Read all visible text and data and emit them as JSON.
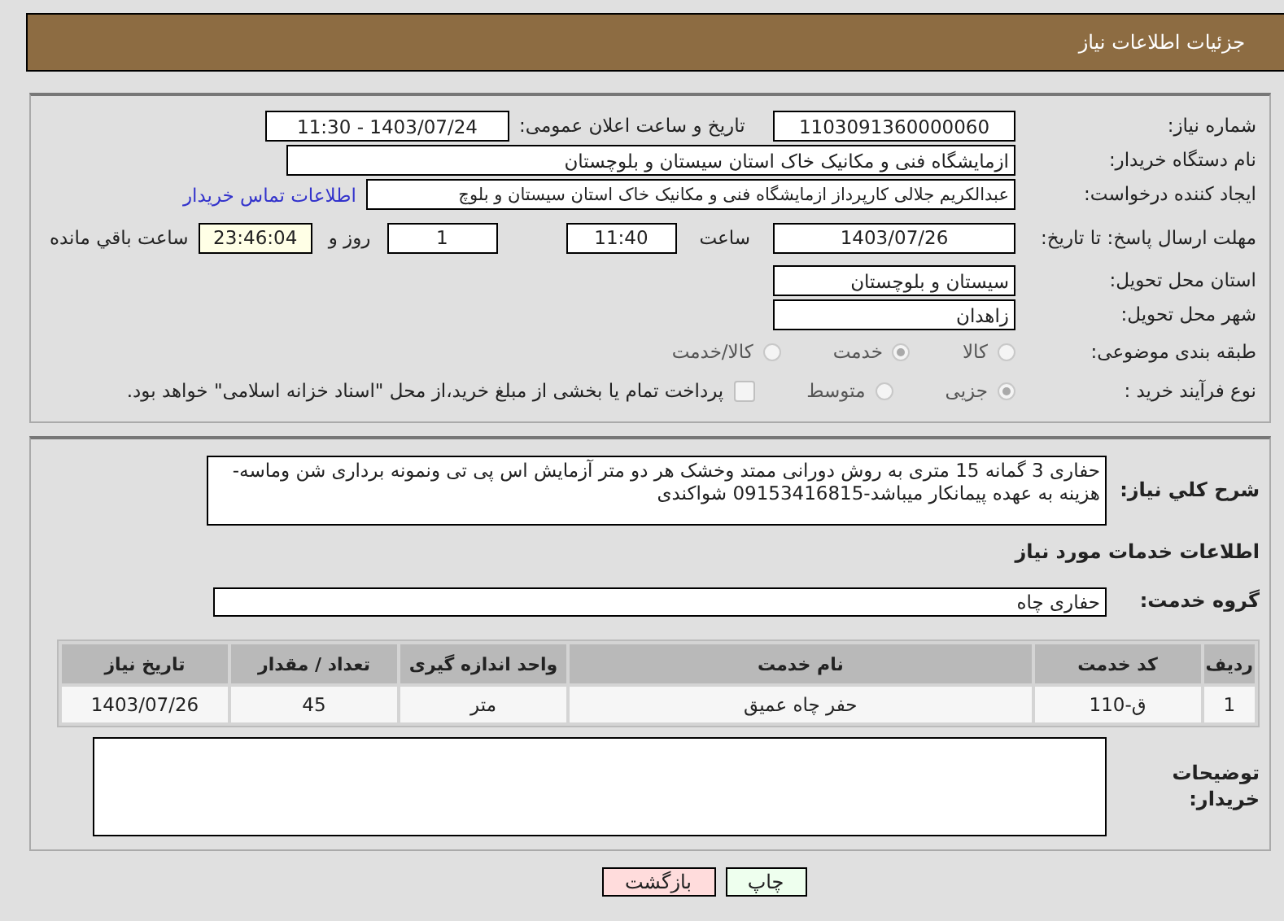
{
  "header": {
    "title": "جزئیات اطلاعات نیاز"
  },
  "need_number": {
    "label": "شماره نیاز:",
    "value": "1103091360000060"
  },
  "announce": {
    "label": "تاریخ و ساعت اعلان عمومی:",
    "value": "1403/07/24 - 11:30"
  },
  "buyer": {
    "label": "نام دستگاه خریدار:",
    "value": "ازمایشگاه فنی و مکانیک خاک استان سیستان و بلوچستان"
  },
  "creator": {
    "label": "ایجاد کننده درخواست:",
    "value": "عبدالکریم جلالی کارپرداز ازمایشگاه فنی و مکانیک خاک استان سیستان و بلوچ",
    "link": "اطلاعات تماس خریدار"
  },
  "deadline": {
    "label": "مهلت ارسال پاسخ: تا تاریخ:",
    "date": "1403/07/26",
    "time_label": "ساعت",
    "time": "11:40",
    "days": "1",
    "days_label": "روز و",
    "remaining": "23:46:04",
    "remaining_label": "ساعت باقي مانده"
  },
  "province": {
    "label": "استان محل تحویل:",
    "value": "سیستان و بلوچستان"
  },
  "city": {
    "label": "شهر محل تحویل:",
    "value": "زاهدان"
  },
  "category": {
    "label": "طبقه بندی موضوعی:",
    "options": [
      {
        "label": "کالا",
        "selected": false
      },
      {
        "label": "خدمت",
        "selected": true
      },
      {
        "label": "کالا/خدمت",
        "selected": false
      }
    ]
  },
  "purchase_type": {
    "label": "نوع فرآیند خرید :",
    "options": [
      {
        "label": "جزیی",
        "selected": true
      },
      {
        "label": "متوسط",
        "selected": false
      }
    ],
    "treasury": {
      "checked": false,
      "text": "پرداخت تمام یا بخشی از مبلغ خرید،از محل \"اسناد خزانه اسلامی\" خواهد بود."
    }
  },
  "description": {
    "label": "شرح کلي نياز:",
    "value": "حفاری 3 گمانه 15 متری به روش دورانی ممتد وخشک هر دو متر آزمایش اس پی تی ونمونه برداری شن وماسه-هزینه به عهده پیمانکار میباشد-09153416815 شواکندی"
  },
  "services_heading": "اطلاعات خدمات مورد نیاز",
  "service_group": {
    "label": "گروه خدمت:",
    "value": "حفاری چاه"
  },
  "table": {
    "columns": [
      "ردیف",
      "کد خدمت",
      "نام خدمت",
      "واحد اندازه گیری",
      "تعداد / مقدار",
      "تاریخ نیاز"
    ],
    "rows": [
      [
        "1",
        "ق-110",
        "حفر چاه عمیق",
        "متر",
        "45",
        "1403/07/26"
      ]
    ]
  },
  "buyer_notes": {
    "label": "توضیحات خریدار:"
  },
  "buttons": [
    {
      "label": "چاپ",
      "kind": "print"
    },
    {
      "label": "بازگشت",
      "kind": "back"
    }
  ]
}
